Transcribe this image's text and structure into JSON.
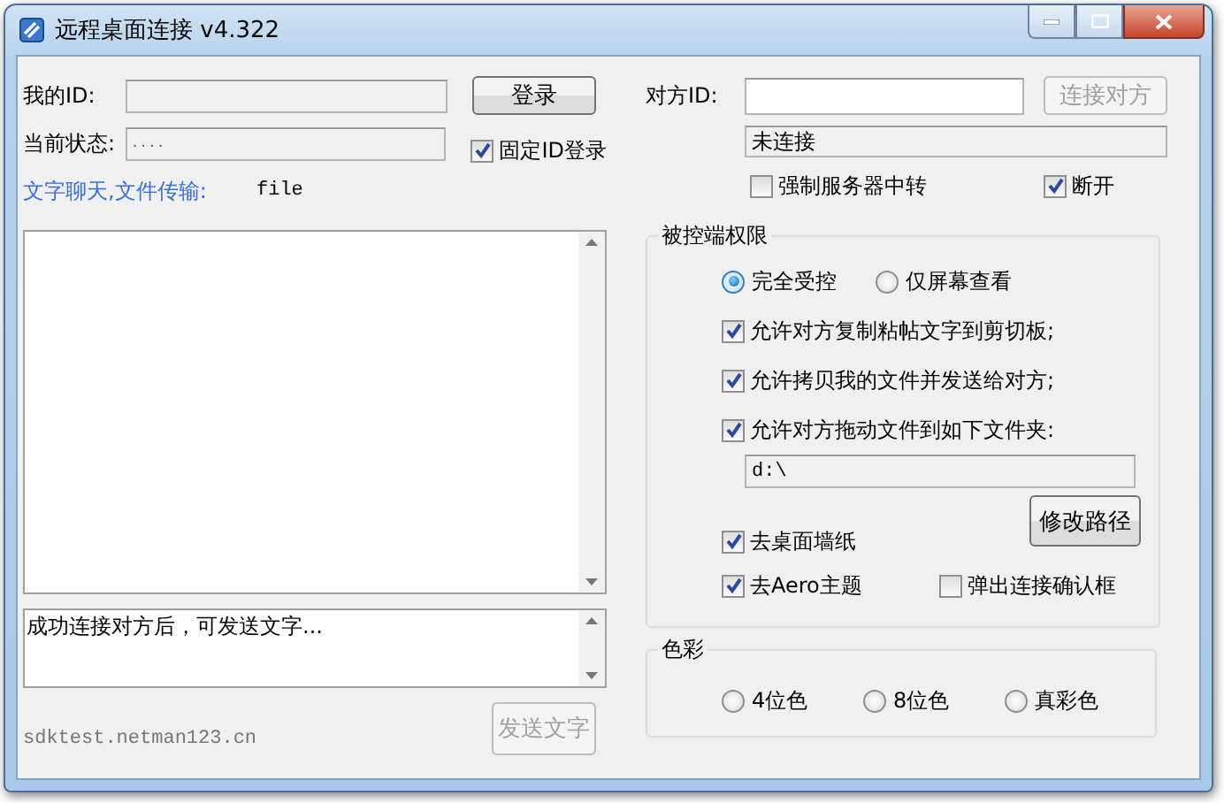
{
  "window": {
    "title": "远程桌面连接 v4.322"
  },
  "my_id": {
    "label": "我的ID:"
  },
  "login_button": {
    "label": "登录",
    "disabled": false
  },
  "status": {
    "label": "当前状态:",
    "value": "...."
  },
  "fixed_id": {
    "label": "固定ID登录",
    "checked": true
  },
  "chat_label": "文字聊天,文件传输:",
  "file_label": "file",
  "message_box": {
    "value": "成功连接对方后，可发送文字..."
  },
  "server": "sdktest.netman123.cn",
  "send_button": {
    "label": "发送文字",
    "disabled": true
  },
  "peer_id": {
    "label": "对方ID:"
  },
  "connect_button": {
    "label": "连接对方",
    "disabled": true
  },
  "connection_status": "未连接",
  "relay": {
    "label": "强制服务器中转",
    "checked": false
  },
  "disconnect": {
    "label": "断开",
    "checked": true
  },
  "permissions": {
    "title": "被控端权限",
    "modes": [
      {
        "label": "完全受控",
        "selected": true
      },
      {
        "label": "仅屏幕查看",
        "selected": false
      }
    ],
    "options": [
      {
        "label": "允许对方复制粘帖文字到剪切板;",
        "checked": true
      },
      {
        "label": "允许拷贝我的文件并发送给对方;",
        "checked": true
      },
      {
        "label": "允许对方拖动文件到如下文件夹:",
        "checked": true
      }
    ],
    "folder": "d:\\",
    "change_path_button": {
      "label": "修改路径",
      "disabled": false
    },
    "extras": [
      {
        "label": "去桌面墙纸",
        "checked": true
      },
      {
        "label": "去Aero主题",
        "checked": true
      },
      {
        "label": "弹出连接确认框",
        "checked": false
      }
    ]
  },
  "color": {
    "title": "色彩",
    "options": [
      {
        "label": "4位色",
        "selected": false
      },
      {
        "label": "8位色",
        "selected": false
      },
      {
        "label": "真彩色",
        "selected": false
      }
    ]
  }
}
